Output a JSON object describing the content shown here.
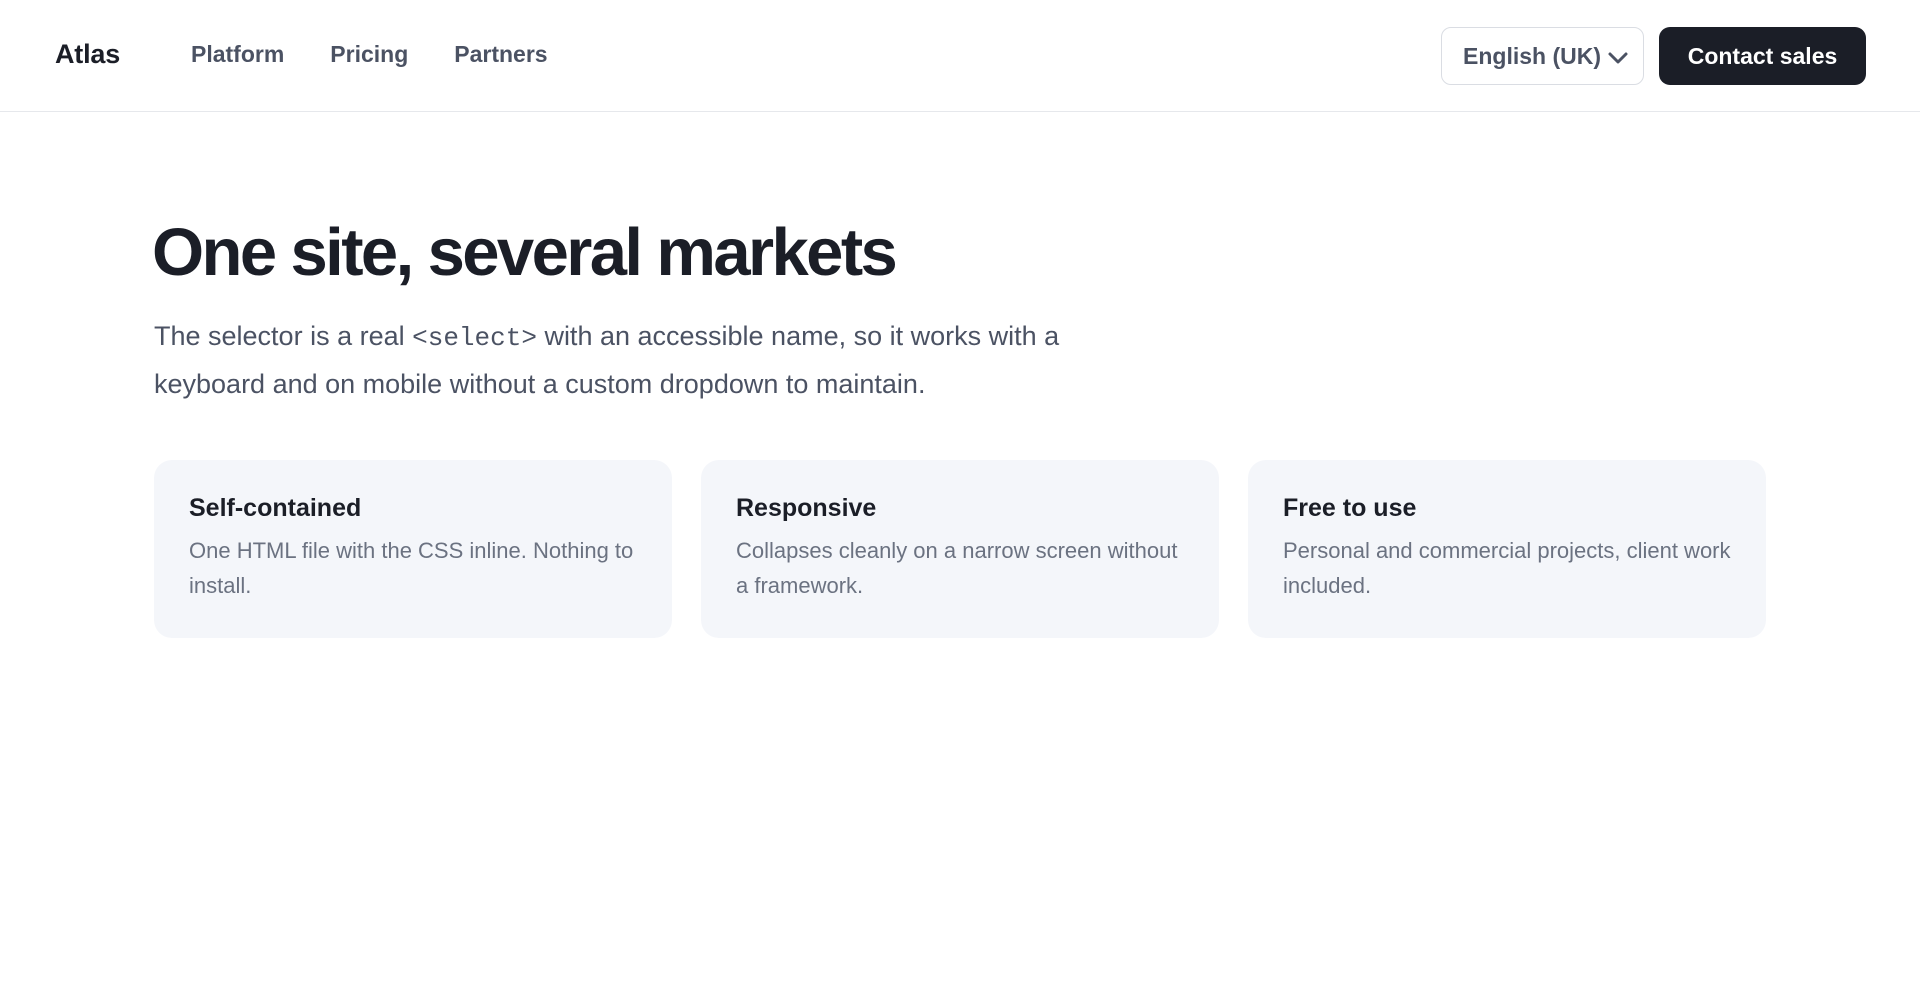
{
  "header": {
    "brand": "Atlas",
    "nav": [
      {
        "label": "Platform"
      },
      {
        "label": "Pricing"
      },
      {
        "label": "Partners"
      }
    ],
    "language_select": {
      "value": "English (UK)",
      "icon": "chevron-down-icon"
    },
    "cta_label": "Contact sales"
  },
  "hero": {
    "title": "One site, several markets",
    "description_before_code": "The selector is a real ",
    "description_code": "<select>",
    "description_after_code": " with an accessible name, so it works with a keyboard and on mobile without a custom dropdown to maintain."
  },
  "features": [
    {
      "title": "Self-contained",
      "text": "One HTML file with the CSS inline. Nothing to install."
    },
    {
      "title": "Responsive",
      "text": "Collapses cleanly on a narrow screen without a framework."
    },
    {
      "title": "Free to use",
      "text": "Personal and commercial projects, client work included."
    }
  ],
  "colors": {
    "text_primary": "#1b1e27",
    "text_secondary": "#4b5263",
    "text_muted": "#6b7281",
    "card_background": "#f4f6fa",
    "cta_background": "#1b1e27",
    "border": "#dadde3"
  }
}
